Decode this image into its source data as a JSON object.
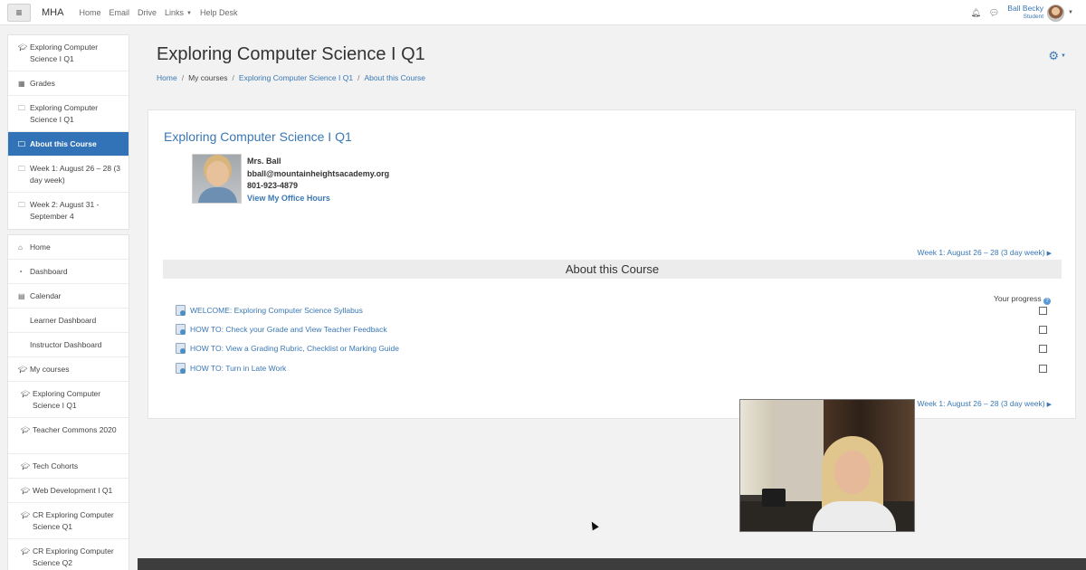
{
  "navbar": {
    "menu_icon": "≡",
    "brand": "MHA",
    "links": [
      {
        "label": "Home",
        "dropdown": false
      },
      {
        "label": "Email",
        "dropdown": false
      },
      {
        "label": "Drive",
        "dropdown": false
      },
      {
        "label": "Links",
        "dropdown": true
      },
      {
        "label": "Help Desk",
        "dropdown": false
      }
    ],
    "icons": [
      "bell-icon",
      "chat-icon"
    ],
    "user": {
      "name": "Ball Becky",
      "role": "Student"
    }
  },
  "sidebar": {
    "course_group": [
      {
        "icon": "graduation-cap-icon",
        "label": "Exploring Computer Science I Q1"
      },
      {
        "icon": "table-icon",
        "label": "Grades"
      },
      {
        "icon": "folder-icon",
        "label": "Exploring Computer Science I Q1"
      },
      {
        "icon": "folder-icon",
        "label": "About this Course",
        "active": true
      },
      {
        "icon": "folder-icon",
        "label": "Week 1: August 26 – 28 (3 day week)"
      },
      {
        "icon": "folder-icon",
        "label": "Week 2: August 31 - September 4"
      }
    ],
    "site_group": [
      {
        "icon": "home-icon",
        "label": "Home"
      },
      {
        "icon": "dashboard-icon",
        "label": "Dashboard"
      },
      {
        "icon": "calendar-icon",
        "label": "Calendar"
      },
      {
        "icon": "",
        "label": "Learner Dashboard"
      },
      {
        "icon": "",
        "label": "Instructor Dashboard"
      },
      {
        "icon": "graduation-cap-icon",
        "label": "My courses"
      },
      {
        "icon": "graduation-cap-icon",
        "label": "Exploring Computer Science I Q1",
        "indent": true
      },
      {
        "icon": "graduation-cap-icon",
        "label": "Teacher Commons 2020",
        "indent": true
      },
      {
        "icon": "graduation-cap-icon",
        "label": "Tech Cohorts",
        "indent": true
      },
      {
        "icon": "graduation-cap-icon",
        "label": "Web Development I Q1",
        "indent": true
      },
      {
        "icon": "graduation-cap-icon",
        "label": "CR Exploring Computer Science Q1",
        "indent": true
      },
      {
        "icon": "graduation-cap-icon",
        "label": "CR Exploring Computer Science Q2",
        "indent": true
      }
    ]
  },
  "main": {
    "title": "Exploring Computer Science I Q1",
    "breadcrumb": [
      "Home",
      "My courses",
      "Exploring Computer Science I Q1",
      "About this Course"
    ],
    "course_link": "Exploring Computer Science I Q1",
    "teacher": {
      "name": "Mrs. Ball",
      "email": "bball@mountainheightsacademy.org",
      "phone": "801-923-4879",
      "office_hours": "View My Office Hours"
    },
    "week_nav_label": "Week 1: August 26 – 28 (3 day week)",
    "section_title": "About this Course",
    "progress_label": "Your progress",
    "activities": [
      "WELCOME: Exploring Computer Science Syllabus",
      "HOW TO: Check your Grade and View Teacher Feedback",
      "HOW TO: View a Grading Rubric, Checklist or Marking Guide",
      "HOW TO: Turn in Late Work"
    ]
  },
  "colors": {
    "link": "#3a78b4",
    "active_sidebar": "#3173b6",
    "page_bg": "#f2f2f2"
  }
}
